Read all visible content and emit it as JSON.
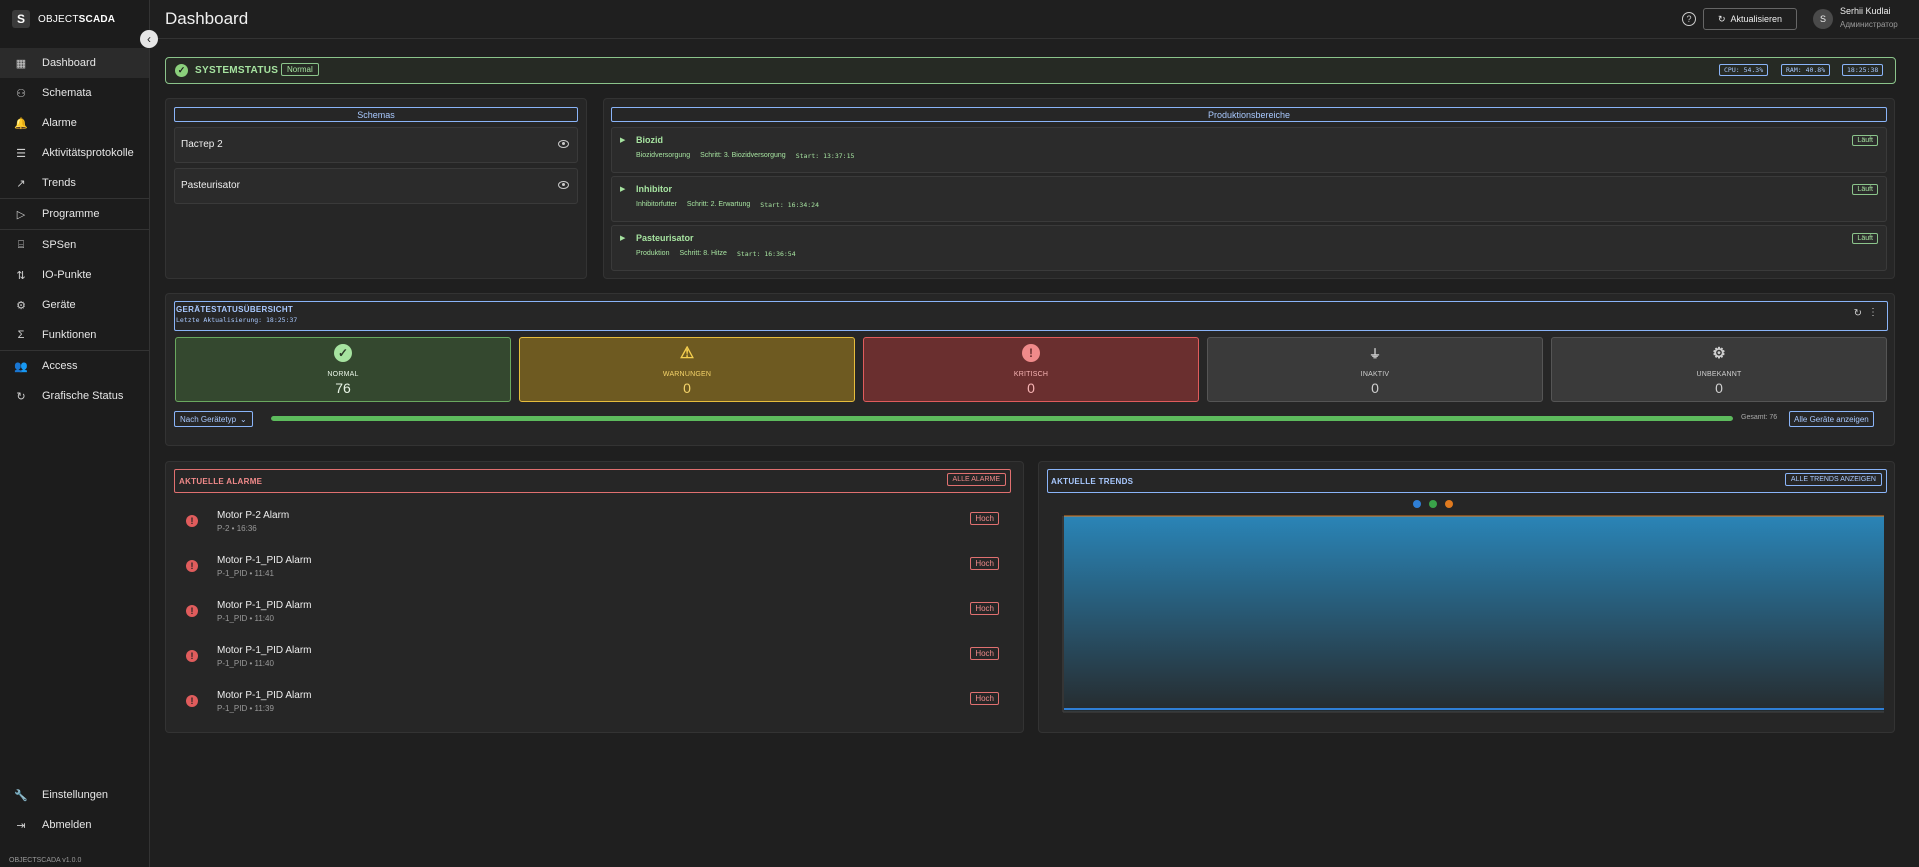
{
  "sidebar": {
    "brand": {
      "logo_letter": "S",
      "name_light": "OBJECT",
      "name_bold": "SCADA"
    },
    "collapse_icon": "chevron-left-icon",
    "items": [
      {
        "label": "Dashboard",
        "icon": "grid-icon",
        "glyph": "▦",
        "active": true
      },
      {
        "label": "Schemata",
        "icon": "sitemap-icon",
        "glyph": "⚇"
      },
      {
        "label": "Alarme",
        "icon": "bell-icon",
        "glyph": "🔔"
      },
      {
        "label": "Aktivitätsprotokolle",
        "icon": "list-icon",
        "glyph": "☰"
      },
      {
        "label": "Trends",
        "icon": "trend-up-icon",
        "glyph": "↗"
      },
      {
        "label": "Programme",
        "icon": "play-icon",
        "glyph": "▷"
      },
      {
        "label": "SPSen",
        "icon": "router-icon",
        "glyph": "⌸"
      },
      {
        "label": "IO-Punkte",
        "icon": "io-icon",
        "glyph": "⇅"
      },
      {
        "label": "Geräte",
        "icon": "gear-icon",
        "glyph": "⚙"
      },
      {
        "label": "Funktionen",
        "icon": "sigma-icon",
        "glyph": "Σ"
      },
      {
        "label": "Access",
        "icon": "users-icon",
        "glyph": "👥"
      },
      {
        "label": "Grafische Status",
        "icon": "refresh-icon",
        "glyph": "↻"
      }
    ],
    "bottom": [
      {
        "label": "Einstellungen",
        "icon": "wrench-icon",
        "glyph": "🔧"
      },
      {
        "label": "Abmelden",
        "icon": "logout-icon",
        "glyph": "⇥"
      }
    ],
    "version": "OBJECTSCADA v1.0.0"
  },
  "header": {
    "title": "Dashboard",
    "refresh_label": "Aktualisieren",
    "user": {
      "initial": "S",
      "name": "Serhii Kudlai",
      "role": "Администратор"
    }
  },
  "system_status": {
    "label": "SYSTEMSTATUS",
    "badge": "Normal",
    "cpu": "CPU: 54.3%",
    "ram": "RAM: 40.8%",
    "time": "18:25:38"
  },
  "schemas": {
    "title": "Schemas",
    "items": [
      "Пастер 2",
      "Pasteurisator"
    ]
  },
  "production": {
    "title": "Produktionsbereiche",
    "items": [
      {
        "name": "Biozid",
        "process": "Biozidversorgung",
        "step": "Schritt: 3. Biozidversorgung",
        "start": "Start: 13:37:15",
        "status": "Läuft"
      },
      {
        "name": "Inhibitor",
        "process": "Inhibitorfutter",
        "step": "Schritt: 2. Erwartung",
        "start": "Start: 16:34:24",
        "status": "Läuft"
      },
      {
        "name": "Pasteurisator",
        "process": "Produktion",
        "step": "Schritt: 8. Hitze",
        "start": "Start: 16:36:54",
        "status": "Läuft"
      }
    ]
  },
  "device_status": {
    "title": "GERÄTESTATUSÜBERSICHT",
    "last_update": "Letzte Aktualisierung: 18:25:37",
    "tiles": [
      {
        "label": "NORMAL",
        "value": "76",
        "icon": "check-circle-icon"
      },
      {
        "label": "WARNUNGEN",
        "value": "0",
        "icon": "warning-icon"
      },
      {
        "label": "KRITISCH",
        "value": "0",
        "icon": "error-icon"
      },
      {
        "label": "INAKTIV",
        "value": "0",
        "icon": "unplugged-icon"
      },
      {
        "label": "UNBEKANNT",
        "value": "0",
        "icon": "gear-icon"
      }
    ],
    "filter_label": "Nach Gerätetyp",
    "progress_fraction": 1.0,
    "total": "Gesamt: 76",
    "all_button": "Alle Geräte anzeigen"
  },
  "alarms": {
    "title": "AKTUELLE ALARME",
    "all_button": "ALLE ALARME",
    "items": [
      {
        "name": "Motor P-2 Alarm",
        "sub": "P-2 • 16:36",
        "severity": "Hoch"
      },
      {
        "name": "Motor P-1_PID Alarm",
        "sub": "P-1_PID • 11:41",
        "severity": "Hoch"
      },
      {
        "name": "Motor P-1_PID Alarm",
        "sub": "P-1_PID • 11:40",
        "severity": "Hoch"
      },
      {
        "name": "Motor P-1_PID Alarm",
        "sub": "P-1_PID • 11:40",
        "severity": "Hoch"
      },
      {
        "name": "Motor P-1_PID Alarm",
        "sub": "P-1_PID • 11:39",
        "severity": "Hoch"
      }
    ]
  },
  "trends": {
    "title": "AKTUELLE TRENDS",
    "all_button": "ALLE TRENDS ANZEIGEN",
    "legend_colors": [
      "#2f7fd6",
      "#3aa34a",
      "#e07a1f"
    ],
    "area_color": "#2a8fc7"
  }
}
